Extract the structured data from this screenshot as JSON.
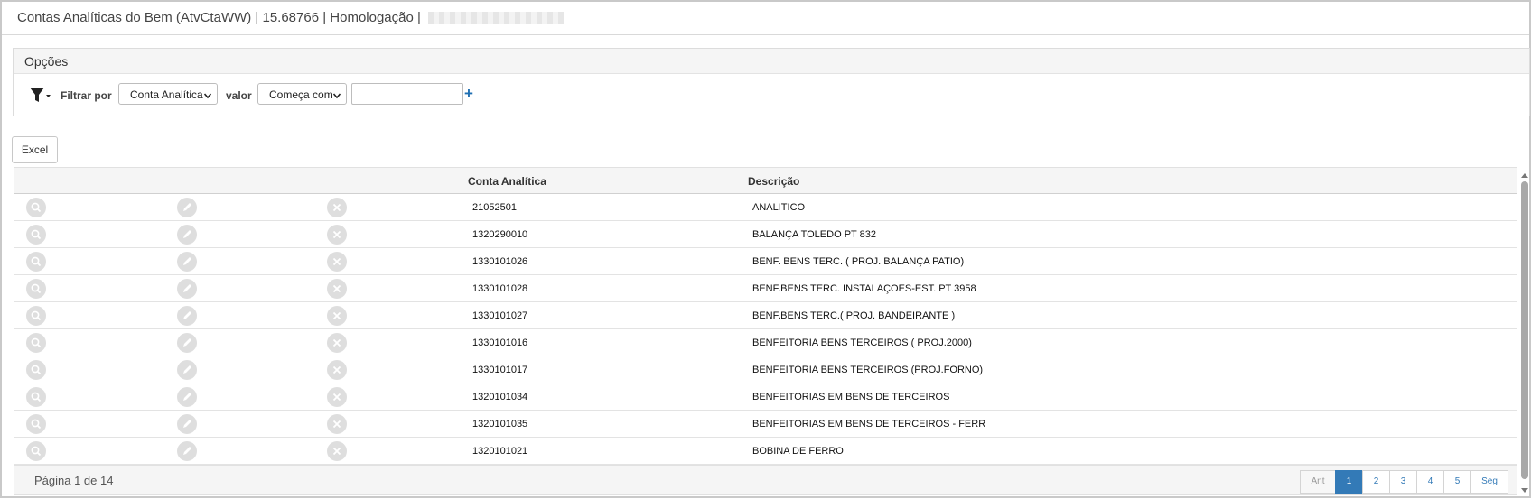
{
  "window": {
    "title": "Contas Analíticas do Bem (AtvCtaWW) | 15.68766 | Homologação |"
  },
  "options": {
    "heading": "Opções",
    "filter_label": "Filtrar por",
    "filter_field": "Conta Analítica",
    "value_label": "valor",
    "operator": "Começa com",
    "value_input": "",
    "add_label": "+"
  },
  "toolbar": {
    "excel_label": "Excel"
  },
  "grid": {
    "columns": [
      "Conta Analítica",
      "Descrição"
    ],
    "rows": [
      {
        "conta": "21052501",
        "descricao": "ANALITICO"
      },
      {
        "conta": "1320290010",
        "descricao": "BALANÇA TOLEDO PT 832"
      },
      {
        "conta": "1330101026",
        "descricao": "BENF. BENS TERC. ( PROJ. BALANÇA PATIO)"
      },
      {
        "conta": "1330101028",
        "descricao": "BENF.BENS TERC. INSTALAÇOES-EST. PT 3958"
      },
      {
        "conta": "1330101027",
        "descricao": "BENF.BENS TERC.( PROJ. BANDEIRANTE )"
      },
      {
        "conta": "1330101016",
        "descricao": "BENFEITORIA BENS TERCEIROS ( PROJ.2000)"
      },
      {
        "conta": "1330101017",
        "descricao": "BENFEITORIA BENS TERCEIROS (PROJ.FORNO)"
      },
      {
        "conta": "1320101034",
        "descricao": "BENFEITORIAS EM BENS DE TERCEIROS"
      },
      {
        "conta": "1320101035",
        "descricao": "BENFEITORIAS EM BENS DE TERCEIROS - FERR"
      },
      {
        "conta": "1320101021",
        "descricao": "BOBINA DE FERRO"
      }
    ],
    "row_actions": [
      "view-icon",
      "edit-icon",
      "delete-icon"
    ]
  },
  "pagination": {
    "info": "Página 1 de 14",
    "prev": "Ant",
    "pages": [
      "1",
      "2",
      "3",
      "4",
      "5"
    ],
    "current": "1",
    "next": "Seg"
  },
  "colors": {
    "accent": "#337ab7",
    "plus": "#1f6fb2"
  }
}
